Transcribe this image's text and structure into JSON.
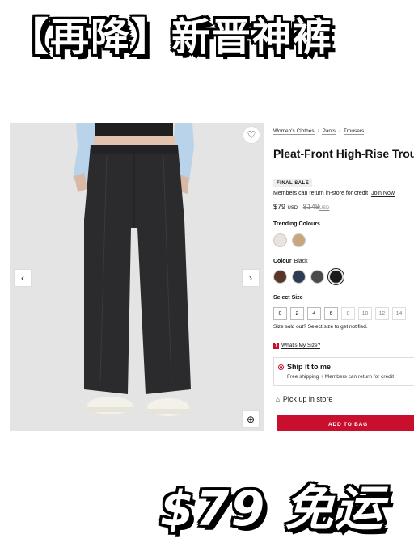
{
  "banner": {
    "top_text": "【再降】新晋神裤",
    "bottom_text": "$79 免运"
  },
  "image": {
    "prev_icon": "chevron-left-icon",
    "next_icon": "chevron-right-icon",
    "wishlist_icon": "heart-icon",
    "zoom_icon": "zoom-icon",
    "prev_glyph": "‹",
    "next_glyph": "›",
    "heart_glyph": "♡",
    "zoom_glyph": "⊕"
  },
  "breadcrumb": [
    "Women's Clothes",
    "Pants",
    "Trousers"
  ],
  "product": {
    "title": "Pleat-Front High-Rise Trouser Regular",
    "badge": "FINAL SALE",
    "credit_text": "Members can return in-store for credit",
    "join_link": "Join Now",
    "price": "$79",
    "price_currency": "USD",
    "old_price": "$148",
    "old_currency": "USD"
  },
  "trending": {
    "label": "Trending Colours",
    "swatches": [
      "#e8e4dc",
      "#c9a77c"
    ]
  },
  "colour": {
    "label": "Colour",
    "selected_name": "Black",
    "swatches": [
      "#5a3628",
      "#2f3b53",
      "#4a4a4a",
      "#1a1a1a"
    ],
    "selected_index": 3
  },
  "size": {
    "label": "Select Size",
    "options": [
      {
        "label": "0",
        "available": true
      },
      {
        "label": "2",
        "available": true
      },
      {
        "label": "4",
        "available": true
      },
      {
        "label": "6",
        "available": true
      },
      {
        "label": "8",
        "available": false
      },
      {
        "label": "10",
        "available": false
      },
      {
        "label": "12",
        "available": false
      },
      {
        "label": "14",
        "available": false
      }
    ],
    "soldout_text": "Size sold out? Select size to get notified.",
    "whats_my_size": "What's My Size?"
  },
  "shipping": {
    "title": "Ship it to me",
    "subtitle": "Free shipping + Members can return for credit",
    "pickup": "Pick up in store"
  },
  "cta": {
    "add_to_bag": "ADD TO BAG"
  }
}
